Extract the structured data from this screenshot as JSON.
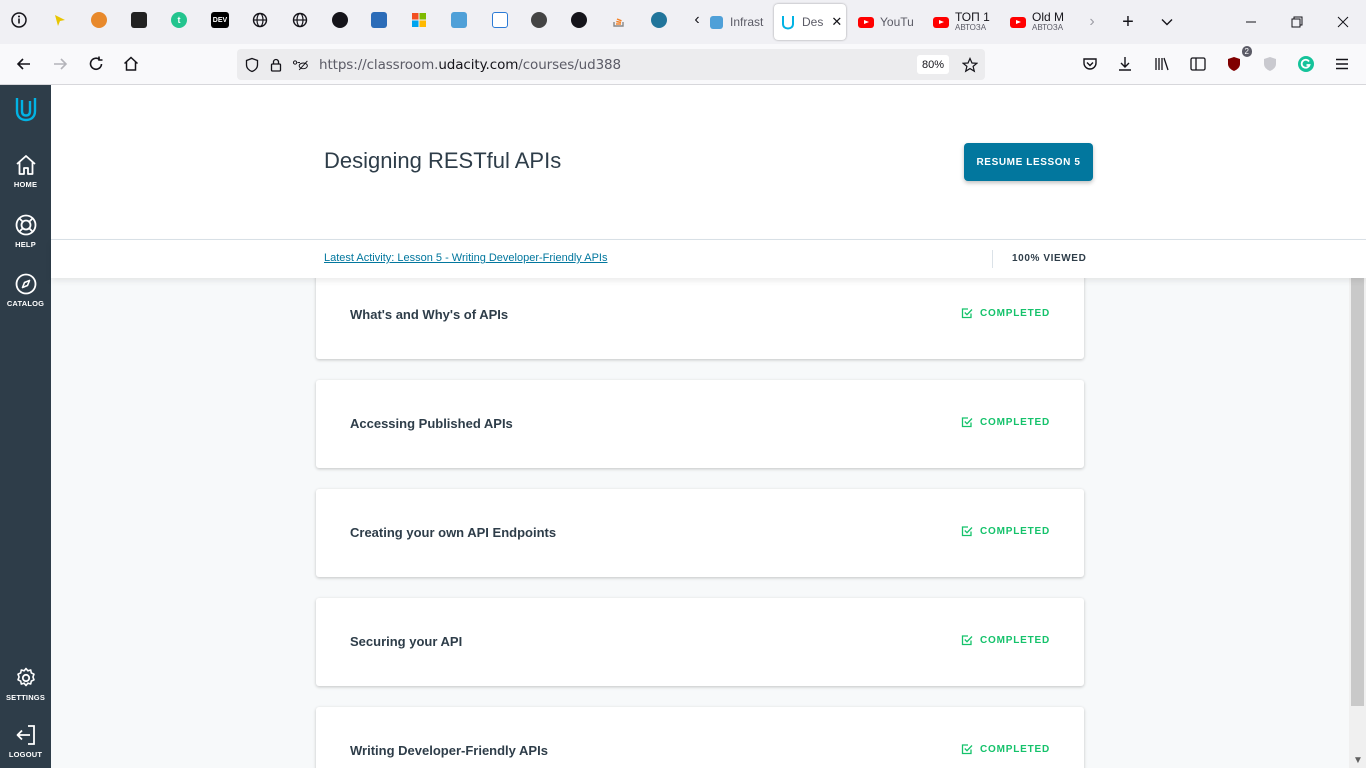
{
  "browser": {
    "tabs": [
      {
        "title": "Infrast",
        "subtitle": ""
      },
      {
        "title": "Des",
        "subtitle": "",
        "active": true
      },
      {
        "title": "YouTu",
        "subtitle": ""
      },
      {
        "title": "ТОП 1",
        "subtitle": "АВТОЗА"
      },
      {
        "title": "Old M",
        "subtitle": "АВТОЗА"
      }
    ],
    "new_tab_label": "+",
    "url_prefix": "https://classroom.",
    "url_host": "udacity.com",
    "url_path": "/courses/ud388",
    "zoom": "80%",
    "extension_badge": "2",
    "pinned_icons": [
      "info-icon",
      "pointer-icon",
      "orange-cog-icon",
      "dark-app-icon",
      "t-circle-icon",
      "dev-icon",
      "globe-icon",
      "globe-icon",
      "github-icon",
      "blue-bank-icon",
      "microsoft-icon",
      "blue-puzzle-icon",
      "window-icon",
      "dark-horse-icon",
      "github-icon",
      "stackoverflow-icon",
      "wordpress-icon"
    ],
    "dev_label": "DEV",
    "t_label": "t"
  },
  "sidebar": {
    "home": "HOME",
    "help": "HELP",
    "catalog": "CATALOG",
    "settings": "SETTINGS",
    "logout": "LOGOUT"
  },
  "course": {
    "title": "Designing RESTful APIs",
    "resume_button": "RESUME LESSON 5",
    "latest_activity": "Latest Activity: Lesson 5 - Writing Developer-Friendly APIs",
    "viewed": "100% VIEWED"
  },
  "lessons": [
    {
      "title": "What's and Why's of APIs",
      "status": "COMPLETED"
    },
    {
      "title": "Accessing Published APIs",
      "status": "COMPLETED"
    },
    {
      "title": "Creating your own API Endpoints",
      "status": "COMPLETED"
    },
    {
      "title": "Securing your API",
      "status": "COMPLETED"
    },
    {
      "title": "Writing Developer-Friendly APIs",
      "status": "COMPLETED"
    }
  ],
  "colors": {
    "sidebar_bg": "#2e3d49",
    "accent": "#02779e",
    "completed": "#15c26b",
    "page_bg": "#f7f9fa"
  }
}
